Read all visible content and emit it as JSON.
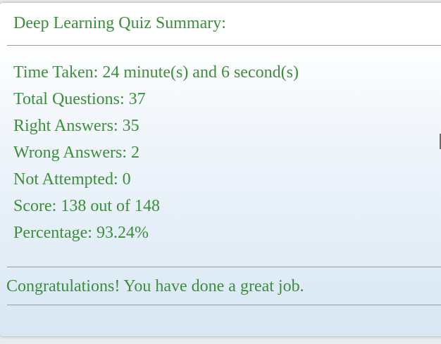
{
  "summary": {
    "title": "Deep Learning Quiz Summary:",
    "stats": [
      "Time Taken: 24 minute(s) and 6 second(s)",
      "Total Questions: 37",
      "Right Answers: 35",
      "Wrong Answers: 2",
      "Not Attempted: 0",
      "Score: 138 out of 148",
      "Percentage: 93.24%"
    ],
    "message": "Congratulations! You have done a great job."
  },
  "colors": {
    "text": "#3b8f3b",
    "divider": "#9a9a9a"
  }
}
